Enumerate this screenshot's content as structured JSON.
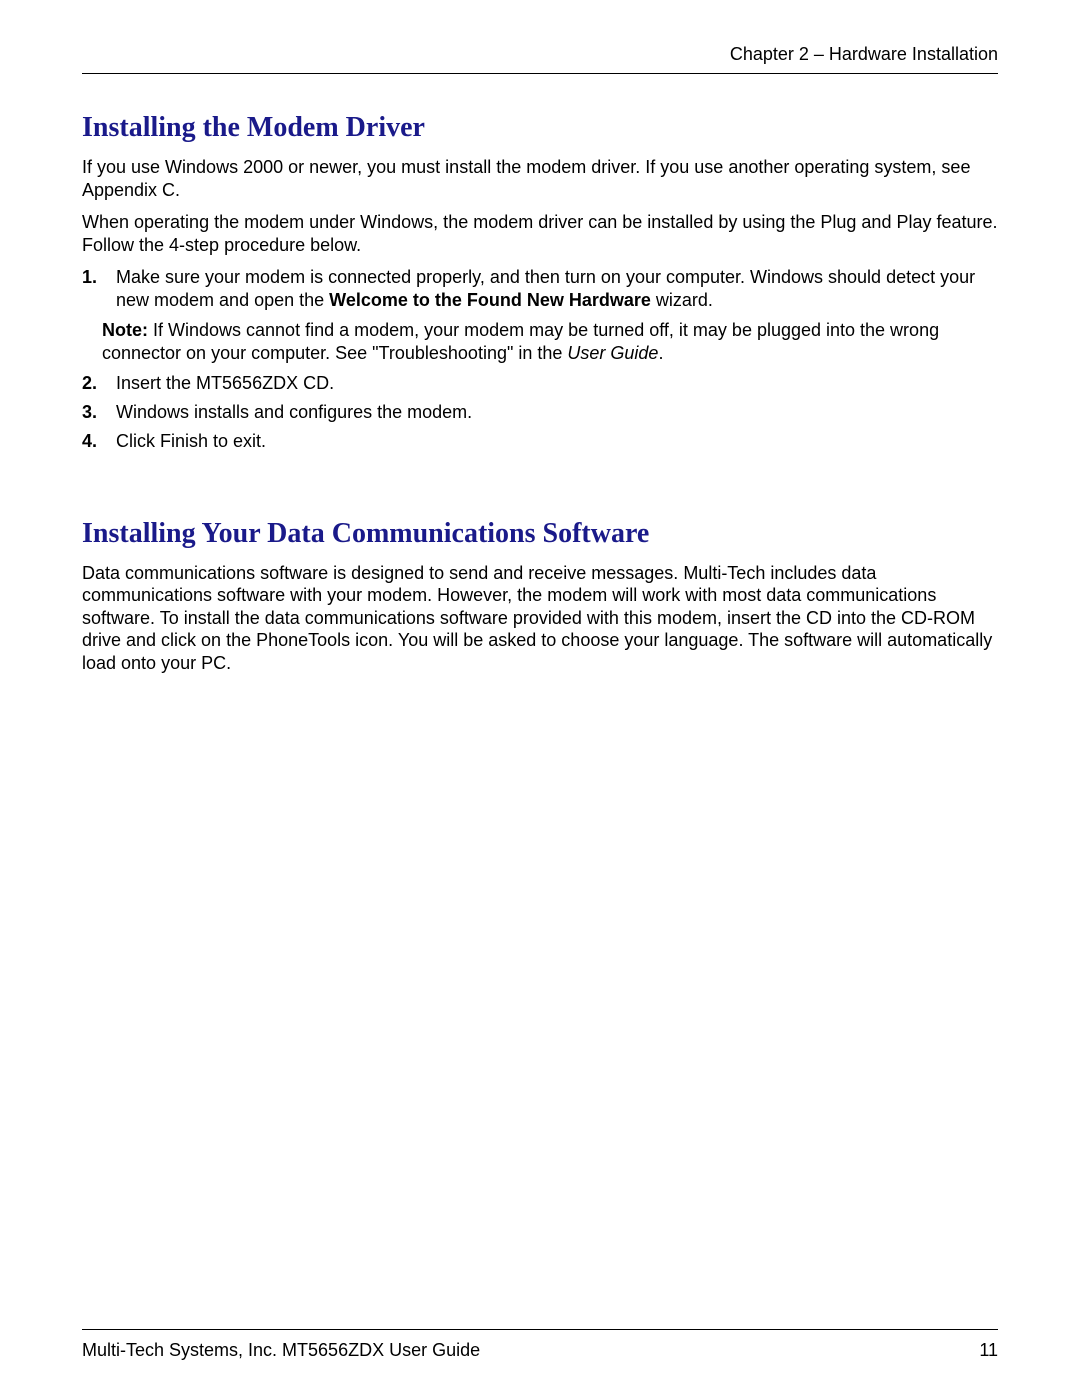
{
  "header": {
    "chapter": "Chapter 2 – Hardware Installation"
  },
  "section1": {
    "title": "Installing the Modem Driver",
    "para1": "If you use Windows 2000 or newer, you must install the modem driver. If you use another operating system, see Appendix C.",
    "para2": "When operating the modem under Windows, the modem driver can be installed by using the Plug and Play feature. Follow the 4-step procedure below.",
    "steps": [
      {
        "num": "1.",
        "text_a": "Make sure your modem is connected properly, and then turn on your computer. Windows should detect your new modem and open the ",
        "text_bold": "Welcome to the Found New Hardware",
        "text_b": " wizard."
      },
      {
        "num": "2.",
        "text": "Insert the MT5656ZDX CD."
      },
      {
        "num": "3.",
        "text": "Windows installs and configures the modem."
      },
      {
        "num": "4.",
        "text": "Click Finish to exit."
      }
    ],
    "note": {
      "label": "Note:",
      "text_a": " If Windows cannot find a modem, your modem may be turned off, it may be plugged into the wrong connector on your computer. See \"Troubleshooting\" in the ",
      "italic": "User Guide",
      "text_b": "."
    }
  },
  "section2": {
    "title": "Installing Your Data Communications Software",
    "para1": "Data communications software is designed to send and receive messages. Multi-Tech includes data communications software with your modem. However, the modem will work with most data communications software. To install the data communications software provided with this modem, insert the CD into the CD-ROM drive and click on the PhoneTools icon. You will be asked to choose your language. The software will automatically load onto your PC."
  },
  "footer": {
    "left": "Multi-Tech Systems, Inc. MT5656ZDX User Guide",
    "right": "11"
  }
}
